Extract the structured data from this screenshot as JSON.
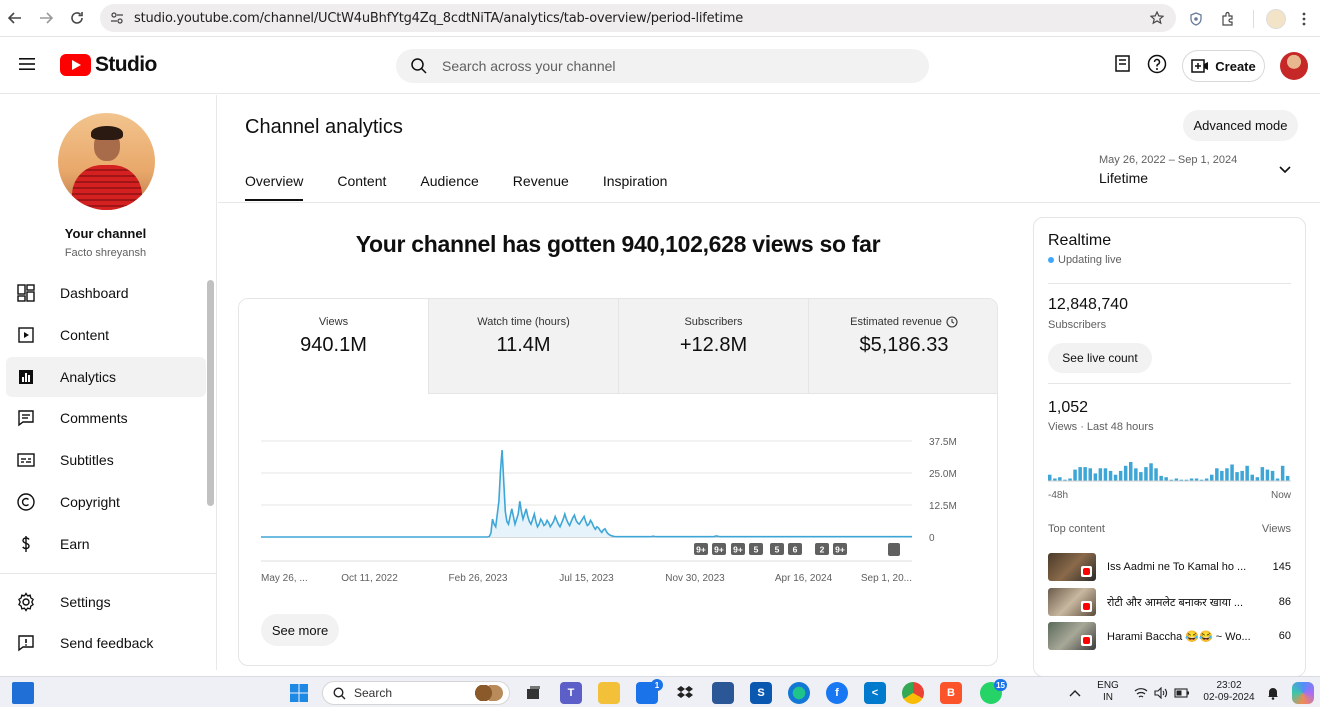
{
  "browser": {
    "url": "studio.youtube.com/channel/UCtW4uBhfYtg4Zq_8cdtNiTA/analytics/tab-overview/period-lifetime"
  },
  "header": {
    "logo_text": "Studio",
    "search_placeholder": "Search across your channel",
    "create_label": "Create"
  },
  "sidebar": {
    "channel_title": "Your channel",
    "channel_name": "Facto shreyansh",
    "items": [
      {
        "label": "Dashboard",
        "icon": "dashboard-icon"
      },
      {
        "label": "Content",
        "icon": "content-icon"
      },
      {
        "label": "Analytics",
        "icon": "analytics-icon",
        "active": true
      },
      {
        "label": "Comments",
        "icon": "comments-icon"
      },
      {
        "label": "Subtitles",
        "icon": "subtitles-icon"
      },
      {
        "label": "Copyright",
        "icon": "copyright-icon"
      },
      {
        "label": "Earn",
        "icon": "earn-icon"
      },
      {
        "label": "Settings",
        "icon": "gear-icon"
      },
      {
        "label": "Send feedback",
        "icon": "feedback-icon"
      }
    ]
  },
  "main": {
    "title": "Channel analytics",
    "advanced_mode": "Advanced mode",
    "tabs": [
      "Overview",
      "Content",
      "Audience",
      "Revenue",
      "Inspiration"
    ],
    "date_range": "May 26, 2022 – Sep 1, 2024",
    "date_label": "Lifetime",
    "headline": "Your channel has gotten 940,102,628 views so far",
    "metrics": [
      {
        "label": "Views",
        "value": "940.1M"
      },
      {
        "label": "Watch time (hours)",
        "value": "11.4M"
      },
      {
        "label": "Subscribers",
        "value": "+12.8M"
      },
      {
        "label": "Estimated revenue",
        "value": "$5,186.33"
      }
    ],
    "see_more": "See more"
  },
  "chart_data": {
    "type": "area",
    "x_ticks": [
      "May 26, ...",
      "Oct 11, 2022",
      "Feb 26, 2023",
      "Jul 15, 2023",
      "Nov 30, 2023",
      "Apr 16, 2024",
      "Sep 1, 20..."
    ],
    "y_ticks": [
      "37.5M",
      "25.0M",
      "12.5M",
      "0"
    ],
    "ylim": [
      0,
      37500000
    ],
    "values": [
      0,
      0,
      0,
      0,
      0,
      0,
      0,
      0,
      0,
      0,
      0,
      0,
      0,
      0,
      0,
      0,
      0,
      0,
      0,
      0,
      0,
      0,
      0,
      0,
      0,
      0,
      0,
      0,
      0,
      0,
      0,
      0,
      0,
      0,
      0,
      0,
      0,
      0,
      0,
      0,
      0,
      0,
      0,
      0,
      0,
      0,
      0,
      0,
      0,
      0,
      0,
      0,
      0,
      0,
      0,
      0,
      0,
      0,
      0,
      0,
      0,
      0,
      0,
      0,
      0,
      0,
      0,
      0,
      0,
      0,
      0,
      0,
      0,
      0,
      0,
      0,
      0,
      0,
      0,
      0,
      0,
      0,
      0,
      0,
      0,
      0,
      0,
      0,
      0,
      0,
      0,
      0,
      0,
      0,
      0,
      0,
      0,
      0,
      0,
      0,
      0,
      0,
      0,
      0,
      0,
      0,
      0,
      0,
      0,
      0,
      0,
      0,
      0,
      0,
      0,
      0,
      0,
      0,
      0,
      0,
      0,
      0,
      0,
      0,
      0,
      0,
      0,
      0,
      0,
      0,
      0,
      0,
      0,
      0,
      0,
      0,
      0,
      0,
      0,
      0,
      0,
      0,
      200000,
      1500000,
      7000000,
      5000000,
      4000000,
      9000000,
      14000000,
      26000000,
      34000000,
      22000000,
      10000000,
      6000000,
      5000000,
      8000000,
      11000000,
      8000000,
      5000000,
      7000000,
      9000000,
      14000000,
      10000000,
      7000000,
      9000000,
      11000000,
      8000000,
      6000000,
      5000000,
      7000000,
      9000000,
      6000000,
      4000000,
      5000000,
      7000000,
      6000000,
      4500000,
      5000000,
      6500000,
      5500000,
      4000000,
      5000000,
      6000000,
      8000000,
      6500000,
      5000000,
      4000000,
      5500000,
      7000000,
      9000000,
      7000000,
      5500000,
      4500000,
      6000000,
      7500000,
      8500000,
      6500000,
      5500000,
      5000000,
      6000000,
      7000000,
      8000000,
      6000000,
      4500000,
      5000000,
      6500000,
      5500000,
      4000000,
      3000000,
      4000000,
      3500000,
      2500000,
      1800000,
      2800000,
      3200000,
      2000000,
      1200000,
      800000,
      500000,
      300000,
      200000,
      100000,
      100000,
      100000,
      100000,
      100000,
      100000,
      100000,
      100000,
      100000,
      100000,
      100000,
      100000,
      100000,
      100000,
      100000,
      100000,
      100000,
      100000,
      100000,
      100000,
      100000,
      100000,
      200000,
      300000,
      200000,
      100000,
      100000,
      100000,
      100000,
      100000,
      100000,
      100000,
      100000,
      100000,
      100000,
      100000,
      100000,
      100000,
      100000,
      100000,
      100000,
      100000,
      100000,
      100000,
      100000,
      100000,
      100000,
      100000,
      100000,
      100000,
      100000,
      100000,
      100000,
      100000,
      100000,
      100000,
      100000,
      100000,
      100000,
      100000,
      100000,
      200000,
      400000,
      300000,
      200000,
      100000,
      100000,
      100000,
      100000,
      100000,
      100000,
      100000,
      100000,
      100000,
      100000,
      100000,
      100000,
      100000,
      100000,
      100000,
      100000,
      100000,
      100000,
      100000,
      100000,
      100000,
      100000,
      100000,
      100000,
      100000,
      100000,
      100000,
      100000,
      100000,
      100000,
      100000,
      100000,
      100000,
      100000,
      100000,
      100000,
      100000,
      100000,
      100000,
      100000,
      100000,
      100000,
      100000,
      100000,
      100000,
      100000,
      100000,
      100000,
      100000,
      100000,
      100000,
      100000,
      100000,
      100000,
      100000,
      100000,
      100000,
      100000,
      100000,
      100000,
      100000,
      100000,
      100000,
      100000,
      100000,
      100000,
      100000,
      100000,
      100000,
      100000,
      100000,
      100000,
      100000,
      100000,
      100000,
      100000,
      100000,
      100000,
      100000,
      100000,
      100000,
      100000,
      100000,
      100000,
      100000,
      100000,
      100000,
      100000,
      100000,
      100000,
      100000,
      100000,
      100000,
      100000,
      100000,
      100000,
      100000,
      100000,
      100000,
      100000,
      100000,
      100000,
      100000,
      100000,
      100000,
      100000,
      100000,
      100000,
      100000,
      100000,
      100000,
      100000,
      100000,
      100000,
      100000,
      100000,
      100000,
      100000,
      100000,
      100000
    ],
    "markers": [
      "9+",
      "9+",
      "9+",
      "5",
      "5",
      "6",
      "2",
      "9+"
    ],
    "color": "#3ea6d6",
    "grid": true
  },
  "realtime": {
    "title": "Realtime",
    "status": "Updating live",
    "subscribers": "12,848,740",
    "subscribers_label": "Subscribers",
    "live_count_label": "See live count",
    "views": "1,052",
    "views_label": "Views · Last 48 hours",
    "axis_left": "-48h",
    "axis_right": "Now",
    "top_content_label": "Top content",
    "views_col_label": "Views",
    "bars": [
      5,
      2,
      3,
      1,
      2,
      9,
      11,
      11,
      10,
      6,
      10,
      10,
      8,
      5,
      8,
      12,
      15,
      10,
      7,
      11,
      14,
      10,
      4,
      3,
      1,
      2,
      1,
      1,
      2,
      2,
      1,
      2,
      5,
      10,
      8,
      10,
      13,
      7,
      8,
      12,
      5,
      3,
      11,
      9,
      8,
      2,
      12,
      4
    ],
    "top_content": [
      {
        "title": "Iss Aadmi ne To Kamal ho ...",
        "views": "145"
      },
      {
        "title": "रोटी और आमलेट बनाकर खाया ...",
        "views": "86"
      },
      {
        "title": "Harami Baccha 😂😂 ~ Wo...",
        "views": "60"
      }
    ]
  },
  "taskbar": {
    "search_label": "Search",
    "lang_top": "ENG",
    "lang_bottom": "IN",
    "time": "23:02",
    "date": "02-09-2024",
    "mail_badge": "1",
    "whatsapp_badge": "15"
  }
}
